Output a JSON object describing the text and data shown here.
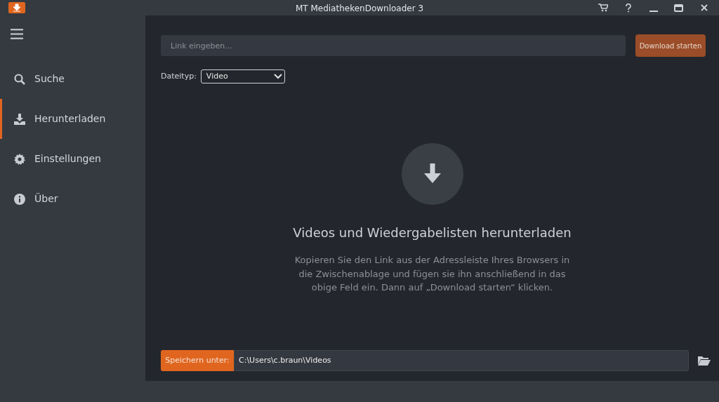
{
  "window": {
    "title": "MT MediathekenDownloader 3"
  },
  "sidebar": {
    "items": [
      {
        "label": "Suche",
        "selected": false
      },
      {
        "label": "Herunterladen",
        "selected": true
      },
      {
        "label": "Einstellungen",
        "selected": false
      },
      {
        "label": "Über",
        "selected": false
      }
    ]
  },
  "link_field": {
    "placeholder": "Link eingeben..."
  },
  "start_button": "Download starten",
  "file_type": {
    "label": "Dateityp:",
    "value": "Video"
  },
  "empty_state": {
    "title": "Videos und Wiedergabelisten herunterladen",
    "text": "Kopieren Sie den Link aus der Adressleiste Ihres Browsers in die Zwischenablage und fügen sie ihn anschließend in das obige Feld ein. Dann auf „Download starten“ klicken."
  },
  "save_location": {
    "label": "Speichern unter:",
    "value": "C:\\Users\\c.braun\\Videos"
  }
}
